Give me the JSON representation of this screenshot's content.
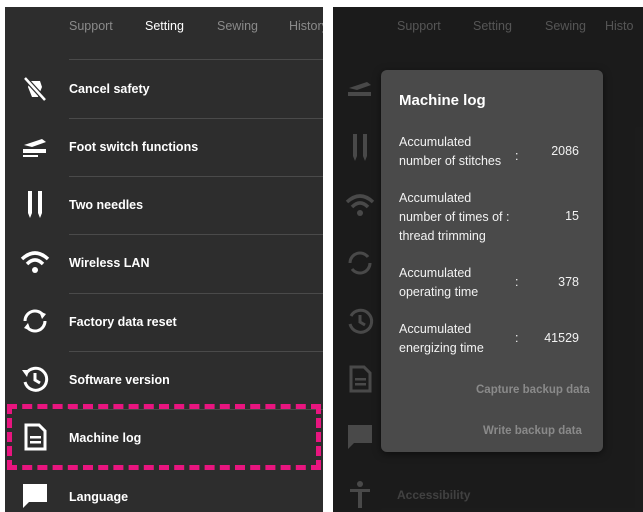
{
  "left": {
    "tabs": [
      "Support",
      "Setting",
      "Sewing",
      "History"
    ],
    "items": [
      {
        "label": "Cancel safety",
        "icon": "cancel-safety-icon"
      },
      {
        "label": "Foot switch functions",
        "icon": "foot-switch-icon"
      },
      {
        "label": "Two needles",
        "icon": "two-needles-icon"
      },
      {
        "label": "Wireless LAN",
        "icon": "wifi-icon"
      },
      {
        "label": "Factory data reset",
        "icon": "reset-icon"
      },
      {
        "label": "Software version",
        "icon": "history-icon"
      },
      {
        "label": "Machine log",
        "icon": "document-icon"
      },
      {
        "label": "Language",
        "icon": "chat-bubble-icon"
      }
    ],
    "highlighted_item": "Machine log"
  },
  "right": {
    "tabs": [
      "Support",
      "Setting",
      "Sewing",
      "Histo"
    ],
    "background_item": "Accessibility",
    "dialog": {
      "title": "Machine log",
      "rows": [
        {
          "label_lines": [
            "Accumulated",
            "number of stitches"
          ],
          "colon": ":",
          "value": "2086"
        },
        {
          "label_lines": [
            "Accumulated",
            "number of times of :",
            "thread trimming"
          ],
          "colon": "",
          "value": "15"
        },
        {
          "label_lines": [
            "Accumulated",
            "operating time"
          ],
          "colon": ":",
          "value": "378"
        },
        {
          "label_lines": [
            "Accumulated",
            "energizing time"
          ],
          "colon": ":",
          "value": "41529"
        }
      ],
      "capture_label": "Capture backup data",
      "write_label": "Write backup data"
    }
  },
  "colors": {
    "highlight": "#e8157f",
    "panel_bg": "#2d2d2d",
    "dialog_bg": "#4a4a4a"
  }
}
